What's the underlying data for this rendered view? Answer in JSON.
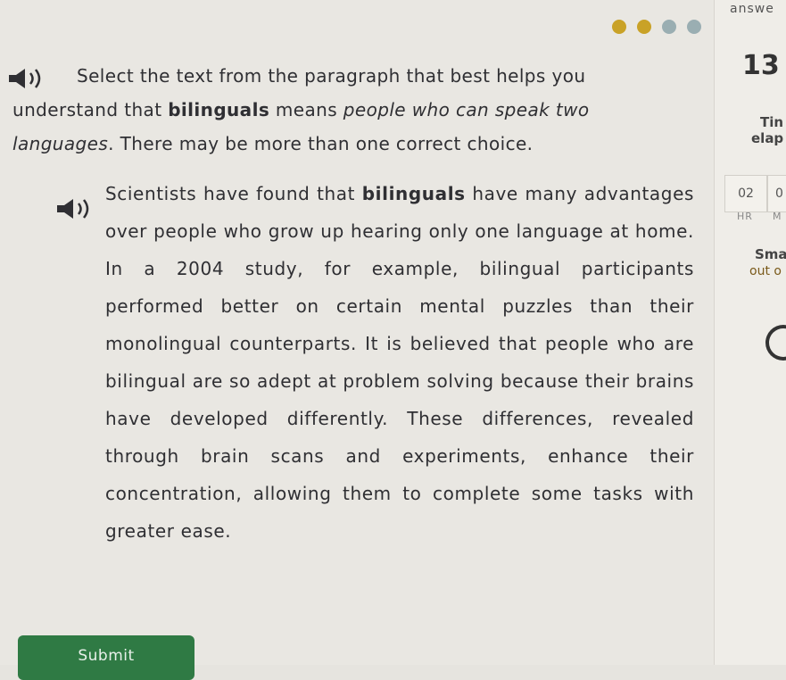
{
  "colors": {
    "dot_filled": "#c9a227",
    "dot_empty": "#9aaeb2",
    "submit_bg": "#2f7a44"
  },
  "progress": {
    "filled": 2,
    "total": 4
  },
  "prompt": {
    "speaker_icon": "speaker-icon",
    "pre": "Select the text from the paragraph that best helps you understand that ",
    "bold": "bilinguals",
    "mid": " means ",
    "italic": "people who can speak two languages",
    "post": ". There may be more than one correct choice."
  },
  "passage": {
    "speaker_icon": "speaker-icon",
    "pre": "Scientists have found that ",
    "bold": "bilinguals",
    "post": " have many advantages over people who grow up hearing only one language at home. In a 2004 study, for example, bilingual participants performed better on certain mental puzzles than their monolingual counterparts. It is believed that people who are bilingual are so adept at problem solving because their brains have developed differently. These differences, revealed through brain scans and experiments, enhance their concentration, allowing them to complete some tasks with greater ease."
  },
  "submit_label": "Submit",
  "sidebar": {
    "answer_label": "answe",
    "question_number": "13",
    "time_label": "Tin",
    "elapsed_label": "elap",
    "hours": "02",
    "minutes": "0",
    "hr_label": "HR",
    "m_label": "M",
    "smart_label": "Smar",
    "outof_label": "out o"
  }
}
